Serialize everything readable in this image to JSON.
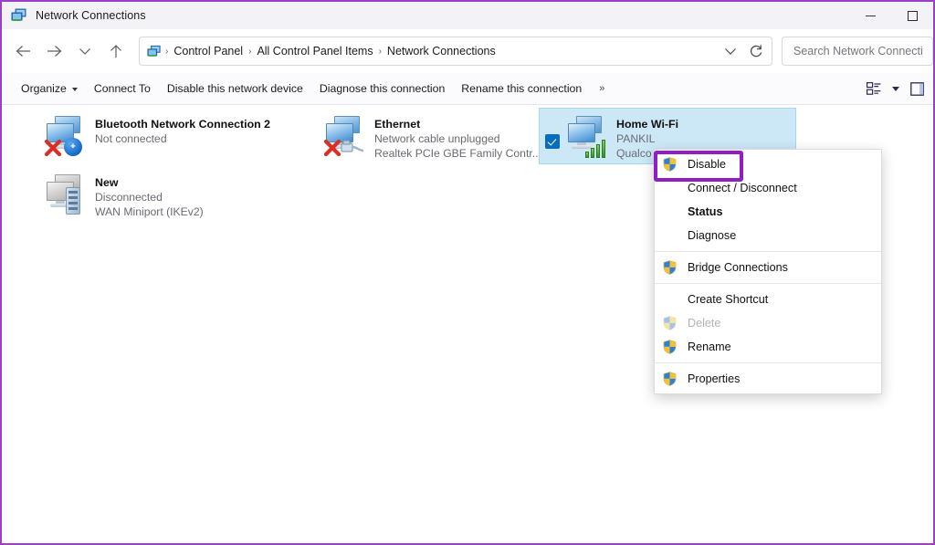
{
  "window": {
    "title": "Network Connections",
    "title_icon": "network-connections-icon",
    "minimize_label": "Minimize",
    "maximize_label": "Maximize",
    "border_color": "#9b3fc4"
  },
  "nav": {
    "back_label": "Back",
    "forward_label": "Forward",
    "recent_label": "Recent locations",
    "up_label": "Up",
    "refresh_label": "Refresh",
    "dropdown_label": "Previous locations",
    "breadcrumbs": [
      "Control Panel",
      "All Control Panel Items",
      "Network Connections"
    ],
    "separator": "›"
  },
  "search": {
    "placeholder": "Search Network Connecti",
    "value": ""
  },
  "toolbar": {
    "items": [
      {
        "label": "Organize",
        "has_caret": true
      },
      {
        "label": "Connect To",
        "has_caret": false
      },
      {
        "label": "Disable this network device",
        "has_caret": false
      },
      {
        "label": "Diagnose this connection",
        "has_caret": false
      },
      {
        "label": "Rename this connection",
        "has_caret": false
      }
    ],
    "overflow": "»",
    "view_icon": "view-options-icon",
    "view_caret_icon": "chevron-down-icon",
    "preview_pane_icon": "preview-pane-icon"
  },
  "connections": [
    {
      "name": "Bluetooth Network Connection 2",
      "status": "Not connected",
      "adapter": "",
      "icon": "bluetooth-network-adapter-icon",
      "badge": "bluetooth",
      "disabled_overlay": true,
      "selected": false,
      "checked": false
    },
    {
      "name": "Ethernet",
      "status": "Network cable unplugged",
      "adapter": "Realtek PCIe GBE Family Contr...",
      "icon": "ethernet-adapter-icon",
      "badge": "cable",
      "disabled_overlay": true,
      "selected": false,
      "checked": true
    },
    {
      "name": "Home Wi-Fi",
      "status": "PANKIL",
      "adapter": "Qualco",
      "icon": "wifi-adapter-icon",
      "badge": "signal-bars",
      "disabled_overlay": false,
      "selected": true,
      "checked": true
    },
    {
      "name": "New",
      "status": "Disconnected",
      "adapter": "WAN Miniport (IKEv2)",
      "icon": "vpn-adapter-icon",
      "badge": "server",
      "disabled_overlay": false,
      "selected": false,
      "checked": false
    }
  ],
  "context_menu": {
    "items": [
      {
        "label": "Disable",
        "shield": true,
        "bold": false,
        "disabled": false,
        "highlighted": true
      },
      {
        "label": "Connect / Disconnect",
        "shield": false,
        "bold": false,
        "disabled": false,
        "highlighted": false
      },
      {
        "label": "Status",
        "shield": false,
        "bold": true,
        "disabled": false,
        "highlighted": false
      },
      {
        "label": "Diagnose",
        "shield": false,
        "bold": false,
        "disabled": false,
        "highlighted": false
      },
      {
        "separator": true
      },
      {
        "label": "Bridge Connections",
        "shield": true,
        "bold": false,
        "disabled": false,
        "highlighted": false
      },
      {
        "separator": true
      },
      {
        "label": "Create Shortcut",
        "shield": false,
        "bold": false,
        "disabled": false,
        "highlighted": false
      },
      {
        "label": "Delete",
        "shield": true,
        "bold": false,
        "disabled": true,
        "highlighted": false
      },
      {
        "label": "Rename",
        "shield": true,
        "bold": false,
        "disabled": false,
        "highlighted": false
      },
      {
        "separator": true
      },
      {
        "label": "Properties",
        "shield": true,
        "bold": false,
        "disabled": false,
        "highlighted": false
      }
    ],
    "highlight_color": "#8f1fc4"
  }
}
